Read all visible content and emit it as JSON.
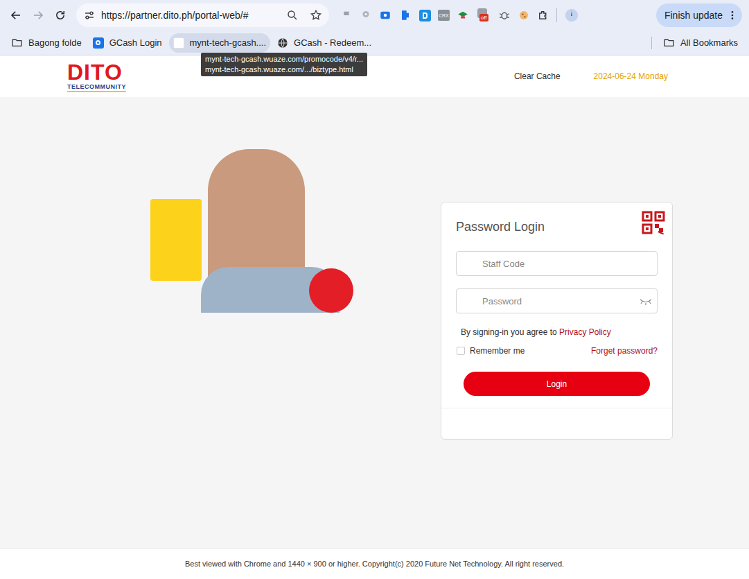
{
  "browser": {
    "url": "https://partner.dito.ph/portal-web/#",
    "update_button": "Finish update",
    "extension_labels": {
      "crx": "CRX",
      "badge": "off"
    }
  },
  "bookmarks": [
    {
      "label": "Bagong folde",
      "kind": "folder",
      "hovered": false
    },
    {
      "label": "GCash Login",
      "kind": "gcash",
      "hovered": false
    },
    {
      "label": "mynt-tech-gcash....",
      "kind": "blank",
      "hovered": true
    },
    {
      "label": "GCash - Redeem...",
      "kind": "globe",
      "hovered": false
    }
  ],
  "all_bookmarks": "All Bookmarks",
  "tooltip": {
    "lines": [
      "mynt-tech-gcash.wuaze.com/promocode/v4/r...",
      "mynt-tech-gcash.wuaze.com/.../biztype.html"
    ]
  },
  "header": {
    "logo": "DITO",
    "logo_sub": "TELECOMMUNITY",
    "clear_cache": "Clear Cache",
    "date": "2024-06-24 Monday"
  },
  "login": {
    "title": "Password Login",
    "staff_placeholder": "Staff Code",
    "password_placeholder": "Password",
    "agree_text": "By signing-in you agree to",
    "privacy_link": "Privacy Policy",
    "remember_label": "Remember me",
    "remember_checked": false,
    "forgot_link": "Forget password?",
    "login_button": "Login"
  },
  "footer": "Best viewed with Chrome and 1440 × 900 or higher. Copyright(c) 2020 Future Net Technology. All right reserved."
}
